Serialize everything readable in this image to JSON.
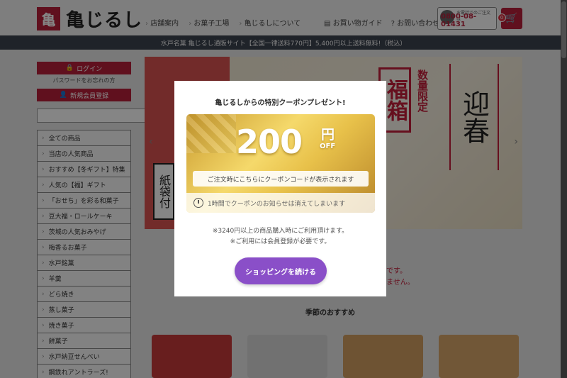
{
  "header": {
    "logo_mark": "亀",
    "logo_text": "亀じるし",
    "nav": [
      "店舗案内",
      "お菓子工場",
      "亀じるしについて"
    ],
    "guide": "お買い物ガイド",
    "contact": "お問い合わせ",
    "phone_caption": "お電話でのご注文は",
    "phone": "0800-08-01431",
    "cart_count": "0"
  },
  "announcement": "水戸名菓 亀じるし通販サイト【全国一律送料770円】5,400円以上送料無料!（税込）",
  "sidebar": {
    "login": "ログイン",
    "forgot_password": "パスワードをお忘れの方",
    "register": "新規会員登録",
    "search_placeholder": "",
    "categories": [
      "全ての商品",
      "当店の人気商品",
      "おすすめ【冬ギフト】特集",
      "人気の【福】ギフト",
      "「おせち」を彩る和菓子",
      "豆大福・ロールケーキ",
      "茨城の人気おみやげ",
      "梅香るお菓子",
      "水戸銘菓",
      "羊羹",
      "どら焼き",
      "蒸し菓子",
      "焼き菓子",
      "餅菓子",
      "水戸納豆せんべい",
      "鋼鉄れアントラーズ!"
    ]
  },
  "hero": {
    "fuku": "福箱",
    "limited": "数量限定",
    "geishun": "迎春",
    "bag": "紙袋付"
  },
  "background": {
    "notice_1": "です。",
    "notice_2": "ません。",
    "season_title": "季節のおすすめ"
  },
  "modal": {
    "title": "亀じるしからの特別クーポンプレゼント!",
    "amount": "200",
    "yen": "円",
    "off": "OFF",
    "code_text": "ご注文時にこちらにクーポンコードが表示されます",
    "timer_text": "1時間でクーポンのお知らせは消えてしまいます",
    "note_1": "※3240円以上の商品購入時にご利用頂けます。",
    "note_2": "※ご利用には会員登録が必要です。",
    "continue_label": "ショッピングを続ける"
  },
  "colors": {
    "brand_red": "#b8203a",
    "continue_purple": "#8a4fc8",
    "coupon_gold": "#e8c14a"
  }
}
